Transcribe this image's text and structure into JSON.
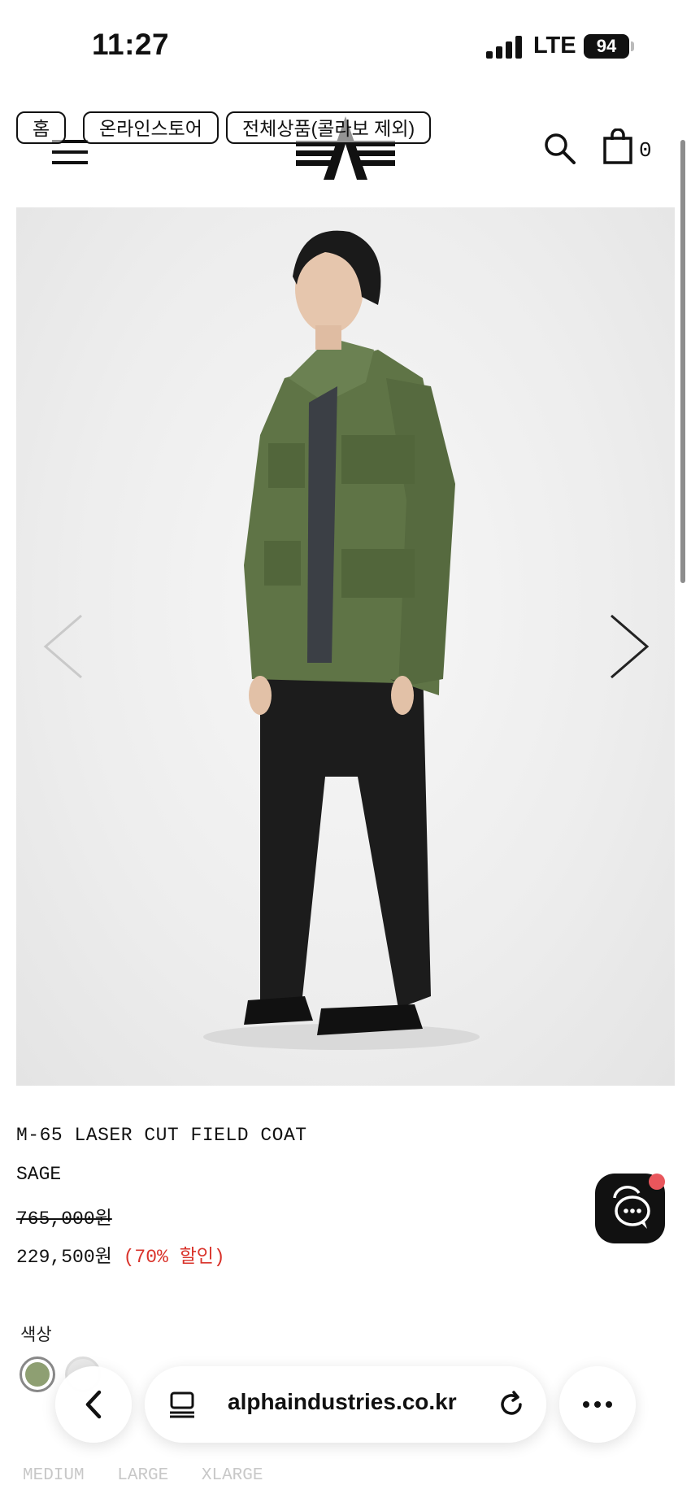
{
  "status_bar": {
    "time": "11:27",
    "network": "LTE",
    "battery": "94"
  },
  "breadcrumb": [
    "홈",
    "온라인스토어",
    "전체상품(콜라보 제외)"
  ],
  "header": {
    "cart_count": "0"
  },
  "product": {
    "name": "M-65 LASER CUT FIELD COAT",
    "color_name": "SAGE",
    "original_price": "765,000원",
    "sale_price": "229,500원",
    "discount": "(70% 할인)",
    "option_label": "색상",
    "sizes": [
      "MEDIUM",
      "LARGE",
      "XLARGE"
    ],
    "swatch_colors": [
      "#8e9f72",
      "#e8e8e8"
    ]
  },
  "browser": {
    "url": "alphaindustries.co.kr"
  },
  "colors": {
    "discount": "#d9332b",
    "chat_badge": "#e9565c",
    "jacket": "#5f7446"
  }
}
